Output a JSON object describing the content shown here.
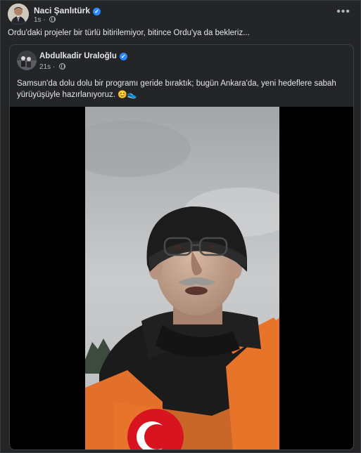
{
  "post": {
    "author": "Naci Şanlıtürk",
    "time": "1s",
    "text": "Ordu'daki projeler bir türlü bitirilemiyor, bitince Ordu'ya da bekleriz..."
  },
  "shared_post": {
    "author": "Abdulkadir Uraloğlu",
    "time": "21s",
    "text": "Samsun'da dolu dolu bir programı geride bıraktık; bugün Ankara'da, yeni hedeflere sabah yürüyüşüyle hazırlanıyoruz.",
    "emojis": "😊👟"
  },
  "icons": {
    "verified": "verified-badge-icon",
    "privacy": "globe-icon",
    "menu": "more-options-icon"
  },
  "colors": {
    "background": "#242526",
    "verified": "#2d88ff",
    "jacket_orange": "#e8742a"
  }
}
